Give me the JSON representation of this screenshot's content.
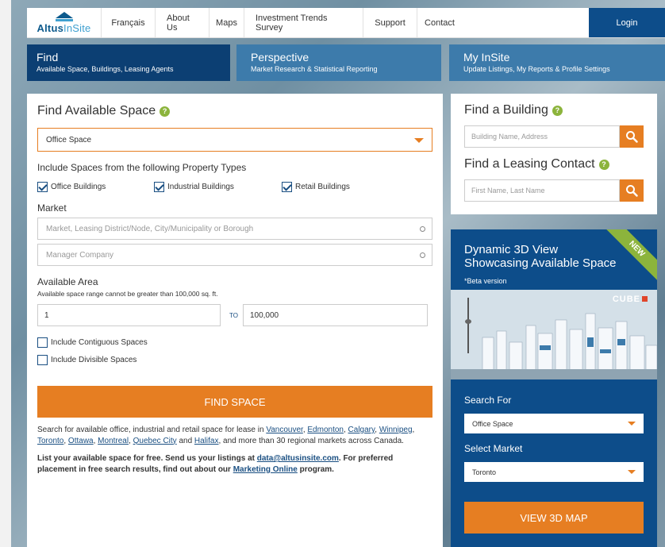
{
  "header": {
    "logo_text_bold": "Altus",
    "logo_text_light": "InSite",
    "nav": [
      "Français",
      "About Us",
      "Maps",
      "Investment Trends Survey",
      "Support",
      "Contact"
    ],
    "login": "Login"
  },
  "tabs": [
    {
      "title": "Find",
      "subtitle": "Available Space, Buildings, Leasing Agents"
    },
    {
      "title": "Perspective",
      "subtitle": "Market Research & Statistical Reporting"
    },
    {
      "title": "My InSite",
      "subtitle": "Update Listings, My Reports & Profile Settings"
    }
  ],
  "find": {
    "title": "Find Available Space",
    "help": "?",
    "space_type": "Office Space",
    "property_types_label": "Include Spaces from the following Property Types",
    "checkboxes": [
      {
        "label": "Office Buildings",
        "checked": true
      },
      {
        "label": "Industrial Buildings",
        "checked": true
      },
      {
        "label": "Retail Buildings",
        "checked": true
      }
    ],
    "market_label": "Market",
    "market_placeholder": "Market, Leasing District/Node, City/Municipality or Borough",
    "manager_placeholder": "Manager Company",
    "area_label": "Available Area",
    "area_note": "Available space range cannot be greater than 100,000 sq. ft.",
    "area_min": "1",
    "to_label": "TO",
    "area_max": "100,000",
    "contiguous": "Include Contiguous Spaces",
    "divisible": "Include Divisible Spaces",
    "find_button": "FIND SPACE",
    "para1": {
      "prefix": "Search for available office, industrial and retail space for lease in ",
      "cities": [
        "Vancouver",
        "Edmonton",
        "Calgary",
        "Winnipeg",
        "Toronto",
        "Ottawa",
        "Montreal",
        "Quebec City",
        "Halifax"
      ],
      "suffix": ", and more than 30 regional markets across Canada."
    },
    "para2": {
      "p1": "List your available space for free. Send us your listings at ",
      "email": "data@altusinsite.com",
      "p2": ". For preferred placement in free search results, find out about our ",
      "link": "Marketing Online",
      "p3": " program."
    }
  },
  "building": {
    "title": "Find a Building",
    "placeholder": "Building Name, Address",
    "contact_title": "Find a Leasing Contact",
    "contact_placeholder": "First Name, Last Name"
  },
  "promo": {
    "title_line1": "Dynamic 3D View",
    "title_line2": "Showcasing Available Space",
    "beta": "*Beta version",
    "ribbon": "NEW",
    "cube": "CUBE",
    "search_for_label": "Search For",
    "search_for_value": "Office Space",
    "market_label": "Select Market",
    "market_value": "Toronto",
    "button": "VIEW 3D MAP"
  },
  "colors": {
    "accent": "#e67e22",
    "navy": "#0d4d8a",
    "tab_dark": "#0c3f73",
    "tab_light": "#3d7bab",
    "help_green": "#8cb43c"
  }
}
